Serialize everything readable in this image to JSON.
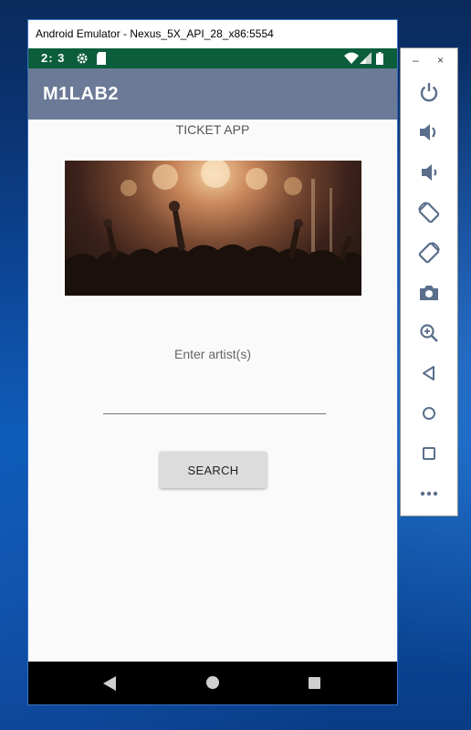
{
  "window": {
    "title": "Android Emulator - Nexus_5X_API_28_x86:5554"
  },
  "status_bar": {
    "time": "2: 3"
  },
  "app_bar": {
    "title": "M1LAB2"
  },
  "main": {
    "subtitle": "TICKET APP",
    "image_alt": "concert crowd",
    "prompt": "Enter artist(s)",
    "input_value": "",
    "search_label": "SEARCH"
  },
  "toolbar": {
    "items": [
      "power-icon",
      "volume-up-icon",
      "volume-down-icon",
      "rotate-left-icon",
      "rotate-right-icon",
      "camera-icon",
      "zoom-icon",
      "back-icon",
      "home-icon",
      "overview-icon",
      "more-icon"
    ]
  },
  "colors": {
    "status_bar": "#0b5d3b",
    "app_bar": "#6b7a96",
    "button": "#dcdcdc",
    "toolbar_icon": "#5b6f8c"
  }
}
